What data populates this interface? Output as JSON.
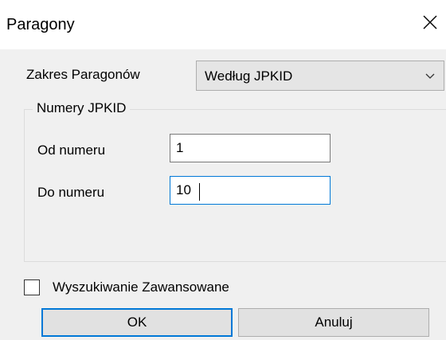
{
  "window": {
    "title": "Paragony",
    "close_icon": "close-icon"
  },
  "range": {
    "label": "Zakres Paragonów",
    "selected": "Według JPKID"
  },
  "group": {
    "caption": "Numery JPKID",
    "from_label": "Od numeru",
    "from_value": "1",
    "to_label": "Do numeru",
    "to_value": "10"
  },
  "advanced_search": {
    "label": "Wyszukiwanie Zawansowane",
    "checked": false
  },
  "buttons": {
    "ok": "OK",
    "cancel": "Anuluj"
  },
  "colors": {
    "accent": "#0078d7",
    "dialog_background": "#f0f0f0"
  }
}
